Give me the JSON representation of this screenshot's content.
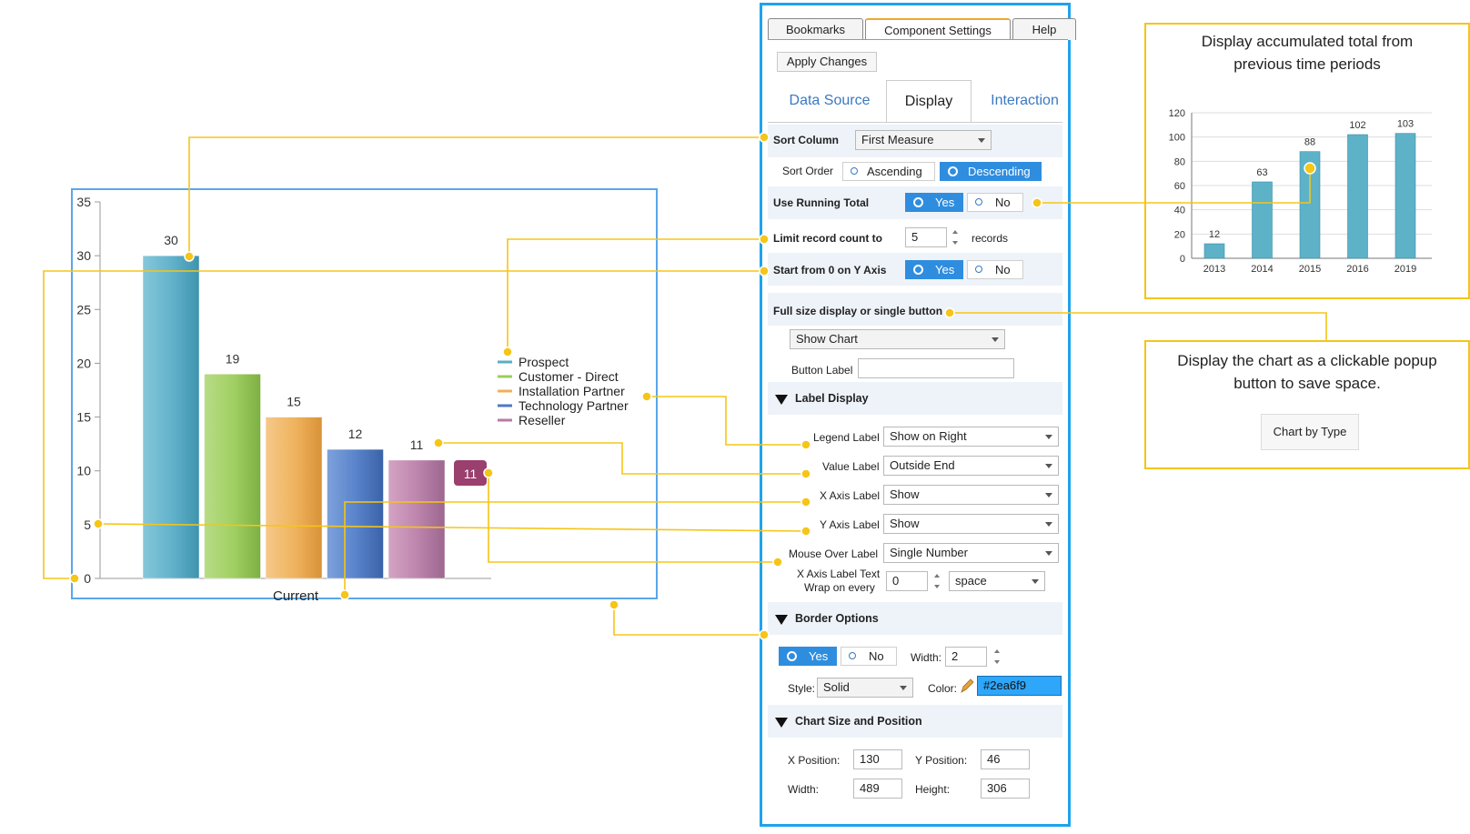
{
  "chart": {
    "y_ticks": [
      "35",
      "30",
      "25",
      "20",
      "15",
      "10",
      "5",
      "0"
    ],
    "x_label": "Current",
    "legend": [
      "Prospect",
      "Customer - Direct",
      "Installation Partner",
      "Technology Partner",
      "Reseller"
    ],
    "tooltip_value": "11",
    "colors": [
      "#5aaec8",
      "#9ccd5c",
      "#f0b058",
      "#4d7ac4",
      "#b87aa6"
    ]
  },
  "chart_data": {
    "type": "bar",
    "categories": [
      "Current"
    ],
    "series": [
      {
        "name": "Prospect",
        "values": [
          30
        ]
      },
      {
        "name": "Customer - Direct",
        "values": [
          19
        ]
      },
      {
        "name": "Installation Partner",
        "values": [
          15
        ]
      },
      {
        "name": "Technology Partner",
        "values": [
          12
        ]
      },
      {
        "name": "Reseller",
        "values": [
          11
        ]
      }
    ],
    "ylim": [
      0,
      35
    ],
    "legend_position": "right"
  },
  "mini_chart": {
    "title": "Display accumulated total from previous time periods",
    "y_ticks": [
      "120",
      "100",
      "80",
      "60",
      "40",
      "20",
      "0"
    ],
    "chart_data": {
      "type": "bar",
      "categories": [
        "2013",
        "2014",
        "2015",
        "2016",
        "2019"
      ],
      "values": [
        12,
        63,
        88,
        102,
        103
      ],
      "ylim": [
        0,
        120
      ]
    }
  },
  "popup_callout": {
    "text": "Display the chart as a clickable popup button to save space.",
    "button_label": "Chart by Type"
  },
  "panel": {
    "top_tabs": [
      "Bookmarks",
      "Component Settings",
      "Help"
    ],
    "apply_button": "Apply Changes",
    "sub_tabs": [
      "Data Source",
      "Display",
      "Interaction"
    ],
    "sort_column": {
      "label": "Sort Column",
      "value": "First Measure"
    },
    "sort_order": {
      "label": "Sort Order",
      "asc": "Ascending",
      "desc": "Descending"
    },
    "running_total": {
      "label": "Use Running Total",
      "yes": "Yes",
      "no": "No"
    },
    "limit": {
      "label": "Limit record count to",
      "value": "5",
      "unit": "records"
    },
    "start_zero": {
      "label": "Start from 0 on Y Axis",
      "yes": "Yes",
      "no": "No"
    },
    "full_size": {
      "label": "Full size display or single button",
      "value": "Show Chart"
    },
    "button_label": {
      "label": "Button Label",
      "value": ""
    },
    "label_display": {
      "title": "Label Display",
      "legend": {
        "label": "Legend Label",
        "value": "Show on Right"
      },
      "value": {
        "label": "Value Label",
        "value": "Outside End"
      },
      "xaxis": {
        "label": "X Axis Label",
        "value": "Show"
      },
      "yaxis": {
        "label": "Y Axis Label",
        "value": "Show"
      },
      "mouse": {
        "label": "Mouse Over Label",
        "value": "Single Number"
      },
      "wrap": {
        "label1": "X Axis Label Text",
        "label2": "Wrap on every",
        "value": "0",
        "unit": "space"
      }
    },
    "border": {
      "title": "Border Options",
      "yes": "Yes",
      "no": "No",
      "width_label": "Width:",
      "width": "2",
      "style_label": "Style:",
      "style": "Solid",
      "color_label": "Color:",
      "color": "#2ea6f9"
    },
    "size": {
      "title": "Chart Size and Position",
      "x_label": "X Position:",
      "x": "130",
      "y_label": "Y Position:",
      "y": "46",
      "w_label": "Width:",
      "w": "489",
      "h_label": "Height:",
      "h": "306"
    }
  }
}
